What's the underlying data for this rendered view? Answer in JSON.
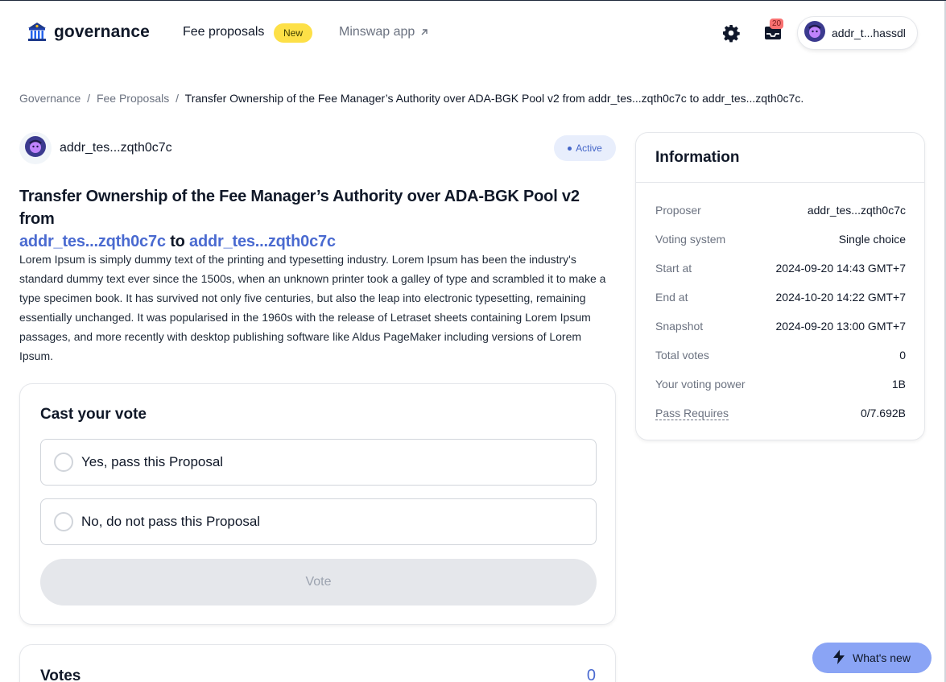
{
  "header": {
    "logo_text": "governance",
    "nav": {
      "fee_proposals": "Fee proposals",
      "new_badge": "New",
      "minswap_app": "Minswap app"
    },
    "notifications_count": "20",
    "user_address": "addr_t...hassdl"
  },
  "breadcrumb": {
    "item1": "Governance",
    "item2": "Fee Proposals",
    "current": "Transfer Ownership of the Fee Manager’s Authority over ADA-BGK Pool v2 from addr_tes...zqth0c7c to addr_tes...zqth0c7c.",
    "separator": "/"
  },
  "proposal": {
    "author": "addr_tes...zqth0c7c",
    "status": "Active",
    "title_prefix": "Transfer Ownership of the Fee Manager’s Authority over ADA-BGK Pool v2 from",
    "from_addr": "addr_tes...zqth0c7c",
    "to_word": "to",
    "to_addr": "addr_tes...zqth0c7c",
    "description": "Lorem Ipsum is simply dummy text of the printing and typesetting industry. Lorem Ipsum has been the industry's standard dummy text ever since the 1500s, when an unknown printer took a galley of type and scrambled it to make a type specimen book. It has survived not only five centuries, but also the leap into electronic typesetting, remaining essentially unchanged. It was popularised in the 1960s with the release of Letraset sheets containing Lorem Ipsum passages, and more recently with desktop publishing software like Aldus PageMaker including versions of Lorem Ipsum."
  },
  "vote": {
    "heading": "Cast your vote",
    "options": [
      {
        "label": "Yes, pass this Proposal"
      },
      {
        "label": "No, do not pass this Proposal"
      }
    ],
    "button_label": "Vote"
  },
  "votes": {
    "title": "Votes",
    "count": "0"
  },
  "information": {
    "title": "Information",
    "rows": [
      {
        "label": "Proposer",
        "value": "addr_tes...zqth0c7c"
      },
      {
        "label": "Voting system",
        "value": "Single choice"
      },
      {
        "label": "Start at",
        "value": "2024-09-20 14:43 GMT+7"
      },
      {
        "label": "End at",
        "value": "2024-10-20 14:22 GMT+7"
      },
      {
        "label": "Snapshot",
        "value": "2024-09-20 13:00 GMT+7"
      },
      {
        "label": "Total votes",
        "value": "0"
      },
      {
        "label": "Your voting power",
        "value": "1B"
      },
      {
        "label": "Pass Requires",
        "value": "0/7.692B"
      }
    ]
  },
  "whats_new": "What's new",
  "colors": {
    "accent_blue": "#4a6ad0",
    "new_badge": "#fde047",
    "active_badge_bg": "#e8eefc",
    "whats_new_bg": "#8aa4f5",
    "notification_badge": "#f87171"
  },
  "icons": {
    "logo": "bank-building-icon",
    "external": "arrow-up-right-icon",
    "settings": "gear-icon",
    "inbox": "inbox-icon",
    "avatar": "avatar-icon",
    "whats_new": "lightning-bolt-icon"
  }
}
